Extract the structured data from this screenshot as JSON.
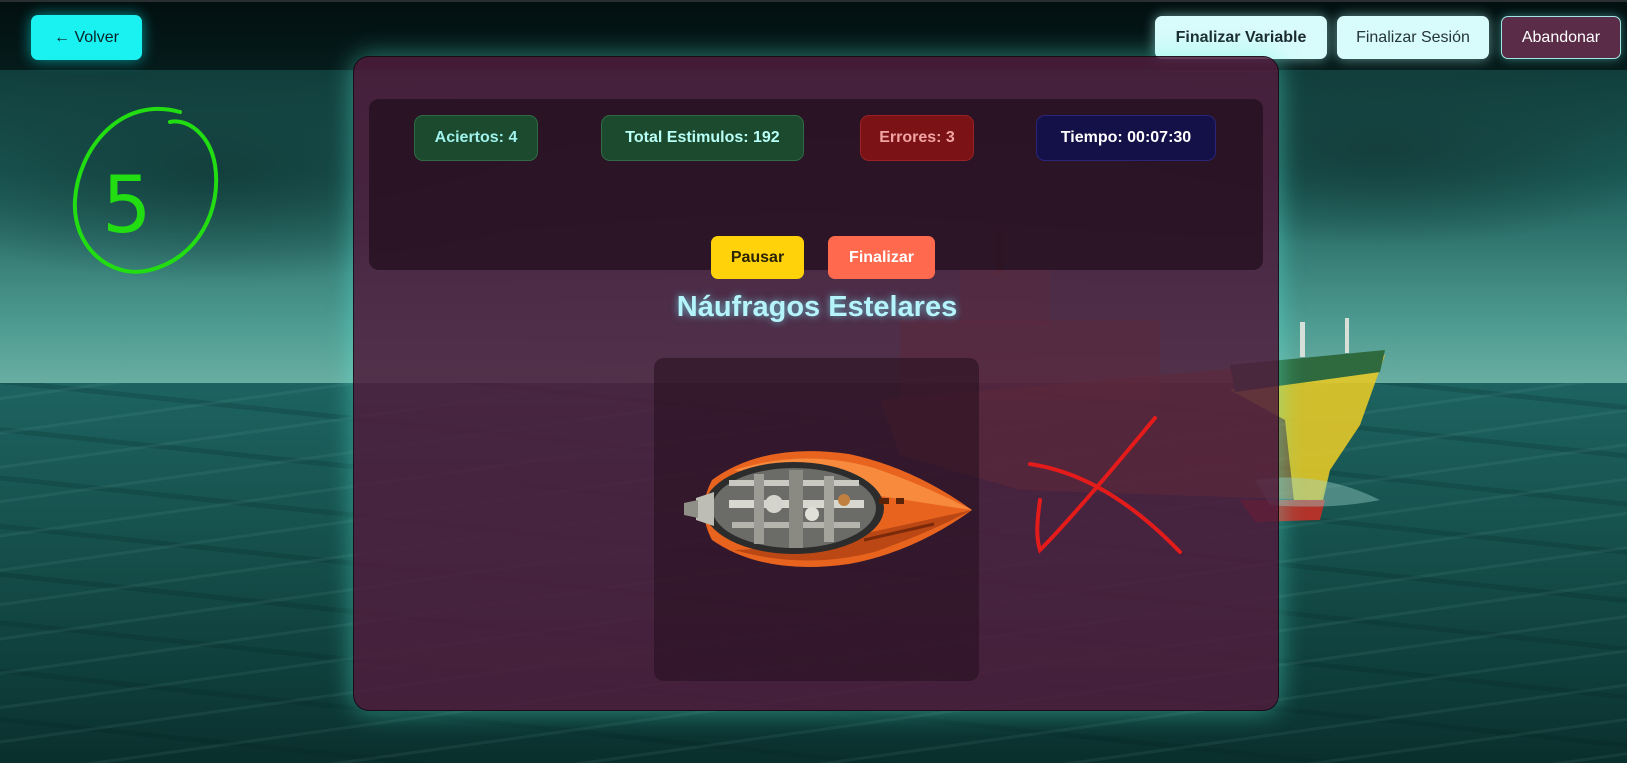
{
  "topbar": {
    "back_label": "← Volver",
    "end_variable_label": "Finalizar Variable",
    "end_session_label": "Finalizar Sesión",
    "abandon_label": "Abandonar"
  },
  "stats": {
    "hits": "Aciertos: 4",
    "total_stimuli": "Total Estimulos: 192",
    "errors": "Errores: 3",
    "time": "Tiempo: 00:07:30"
  },
  "controls": {
    "pause_label": "Pausar",
    "finish_label": "Finalizar"
  },
  "game": {
    "title": "Náufragos Estelares",
    "stimulus_icon": "orange-spaceship"
  },
  "annotations": {
    "circled_number": "5",
    "mark": "red-x",
    "number_color": "#22dd11",
    "mark_color": "#e41b1b"
  },
  "colors": {
    "accent_cyan": "#1af2f2",
    "card_bg": "#4e1c3c",
    "pause": "#ffd20a",
    "finish": "#ff6a4e"
  }
}
